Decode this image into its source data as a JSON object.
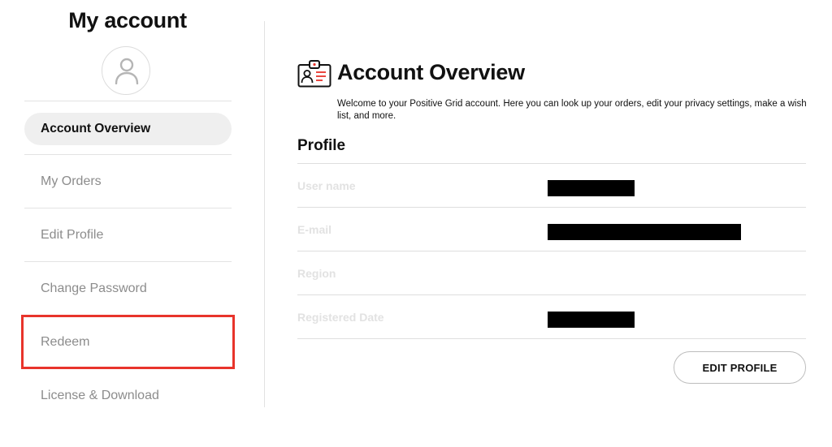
{
  "sidebar": {
    "title": "My account",
    "items": [
      {
        "label": "Account Overview",
        "active": true
      },
      {
        "label": "My Orders"
      },
      {
        "label": "Edit Profile"
      },
      {
        "label": "Change Password"
      },
      {
        "label": "Redeem",
        "highlighted": true
      },
      {
        "label": "License & Download"
      }
    ]
  },
  "main": {
    "title": "Account Overview",
    "welcome": "Welcome to your Positive Grid account. Here you can look up your orders, edit your privacy settings, make a wish list, and more.",
    "profile": {
      "heading": "Profile",
      "fields": [
        {
          "label": "User name",
          "value_redacted": true
        },
        {
          "label": "E-mail",
          "value_redacted": true
        },
        {
          "label": "Region",
          "value_redacted": false
        },
        {
          "label": "Registered Date",
          "value_redacted": true
        }
      ],
      "edit_button": "EDIT PROFILE"
    }
  },
  "colors": {
    "accent_red": "#e8342b",
    "active_pill": "#efefef",
    "nav_text": "#8c8c8c",
    "field_label": "#e2e2e2"
  },
  "icons": {
    "avatar": "user-icon",
    "overview": "id-badge-icon"
  }
}
